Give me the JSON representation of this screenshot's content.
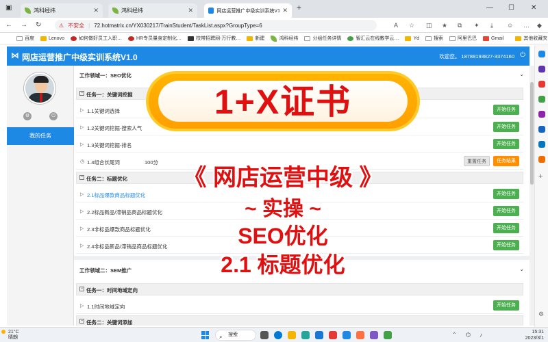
{
  "browser": {
    "tabs": [
      {
        "title": "鸿科经纬",
        "active": false
      },
      {
        "title": "鸿科经纬",
        "active": false
      },
      {
        "title": "网店运营推广中级实训系统V1.0",
        "active": true
      }
    ],
    "new_tab": "+",
    "window_controls": {
      "minimize": "—",
      "maximize": "☐",
      "close": "✕"
    },
    "security_label": "不安全",
    "url": "72.hotmatrix.cn/YX030217/TrainStudent/TaskList.aspx?GroupType=6",
    "bookmarks": [
      "百度",
      "Lenovo",
      "如何做好员工入职…",
      "HR专员量身定制化…",
      "校带招聘网-万行教…",
      "新建",
      "鸿科经纬",
      "分组任务详情",
      "智汇云在线教学云…",
      "Yd",
      "搜索",
      "阿里巴巴",
      "Gmail",
      "其他收藏夹"
    ]
  },
  "app": {
    "title": "网店运营推广中级实训系统V1.0",
    "welcome": "欢迎您。 18788193827-3374160",
    "my_tasks": "我的任务"
  },
  "content": {
    "domain1": "工作领域一：SEO优化",
    "task1": {
      "title": "任务一：关键词挖掘",
      "items": [
        {
          "label": "1.1关键词选择",
          "score": "",
          "buttons": [
            "开始任务"
          ]
        },
        {
          "label": "1.2关键词挖掘-搜索人气",
          "score": "",
          "buttons": [
            "开始任务"
          ]
        },
        {
          "label": "1.3关键词挖掘-排名",
          "score": "",
          "buttons": [
            "开始任务"
          ]
        },
        {
          "label": "1.4组合长尾词",
          "score": "100分",
          "buttons": [
            "重置任务",
            "任务结果"
          ]
        }
      ]
    },
    "task2": {
      "title": "任务二：标题优化",
      "items": [
        {
          "label": "2.1标品爆款商品标题优化",
          "buttons": [
            "开始任务"
          ]
        },
        {
          "label": "2.2标品新品/滞销品商品标题优化",
          "buttons": [
            "开始任务"
          ]
        },
        {
          "label": "2.3非标品爆款商品标题优化",
          "buttons": [
            "开始任务"
          ]
        },
        {
          "label": "2.4非标品新品/滞销品商品标题优化",
          "buttons": [
            "开始任务"
          ]
        }
      ]
    },
    "domain2": "工作领域二：SEM推广",
    "task3": {
      "title": "任务一：时间地域定向",
      "items": [
        {
          "label": "1.1时间地域定向",
          "buttons": [
            "开始任务"
          ]
        }
      ]
    },
    "task4": {
      "title": "任务二：关键词添加"
    }
  },
  "overlay": {
    "banner": "1+X证书",
    "line1": "《 网店运营中级 》",
    "line2": "~ 实操 ~",
    "line3": "SEO优化",
    "line4": "2.1  标题优化"
  },
  "taskbar": {
    "temp": "21°C",
    "weather": "晴朗",
    "search": "搜索",
    "time": "15:31",
    "date": "2023/3/1"
  },
  "colors": {
    "primary": "#1e88e5",
    "green": "#4caf50",
    "orange": "#ff8f00",
    "overlay_red": "#e01010",
    "banner_gold": "#ffa000"
  }
}
